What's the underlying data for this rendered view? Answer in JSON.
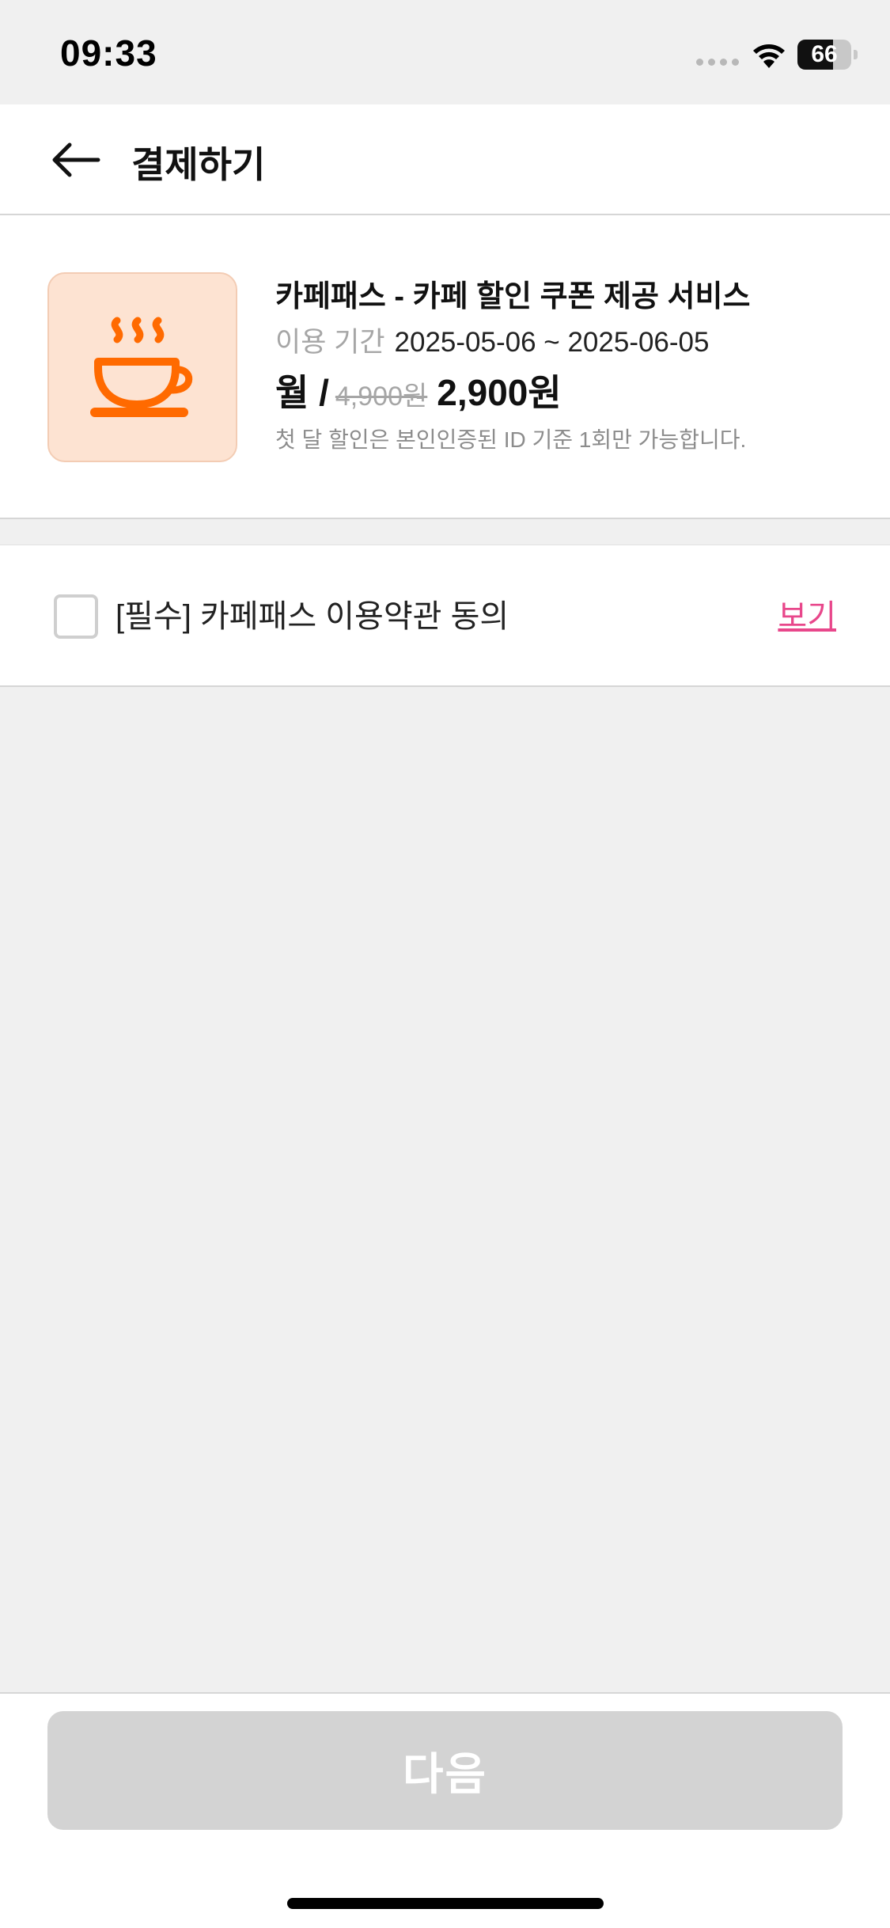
{
  "status_bar": {
    "time": "09:33",
    "battery_level": "66",
    "battery_fraction": 0.66
  },
  "header": {
    "title": "결제하기",
    "back_icon": "arrow-left-icon"
  },
  "product": {
    "icon": "coffee-cup-icon",
    "icon_color": "#ff6a00",
    "icon_bg_color": "#fde3d2",
    "name": "카페패스 - 카페 할인 쿠폰 제공 서비스",
    "period_label": "이용 기간",
    "period_value": "2025-05-06 ~ 2025-06-05",
    "price_unit": "월 /",
    "price_original": "4,900원",
    "price_current": "2,900원",
    "note": "첫 달 할인은 본인인증된 ID 기준 1회만 가능합니다."
  },
  "terms": {
    "label": "[필수] 카페패스 이용약관 동의",
    "checked": false,
    "view_link": "보기",
    "link_color": "#e8478b"
  },
  "footer": {
    "next_button": "다음",
    "next_enabled": false
  }
}
